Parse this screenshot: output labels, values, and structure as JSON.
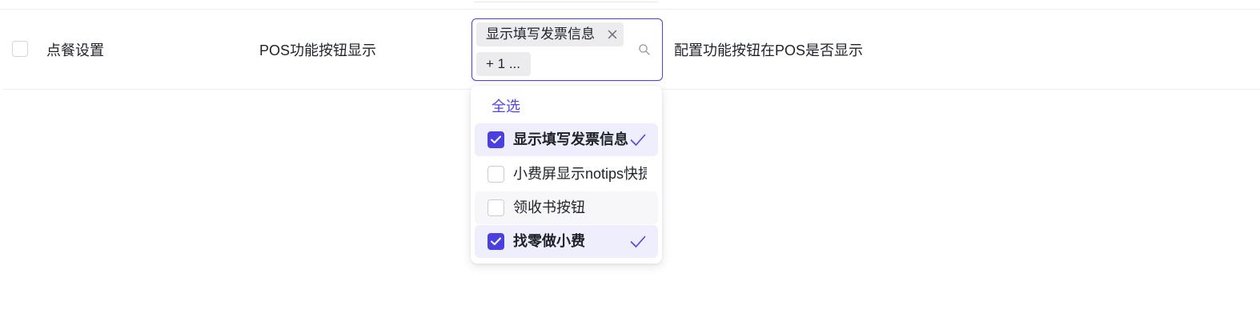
{
  "row": {
    "category": "点餐设置",
    "name": "POS功能按钮显示",
    "description": "配置功能按钮在POS是否显示"
  },
  "select": {
    "tags": [
      {
        "label": "显示填写发票信息"
      },
      {
        "label": "+ 1 ..."
      }
    ],
    "icons": {
      "search": "search-icon",
      "tag_close": "close-icon"
    },
    "accent_color": "#5146e0"
  },
  "dropdown": {
    "select_all_label": "全选",
    "options": [
      {
        "label": "显示填写发票信息",
        "checked": true
      },
      {
        "label": "小费屏显示notips快捷",
        "checked": false
      },
      {
        "label": "领收书按钮",
        "checked": false
      },
      {
        "label": "找零做小费",
        "checked": true
      }
    ]
  }
}
